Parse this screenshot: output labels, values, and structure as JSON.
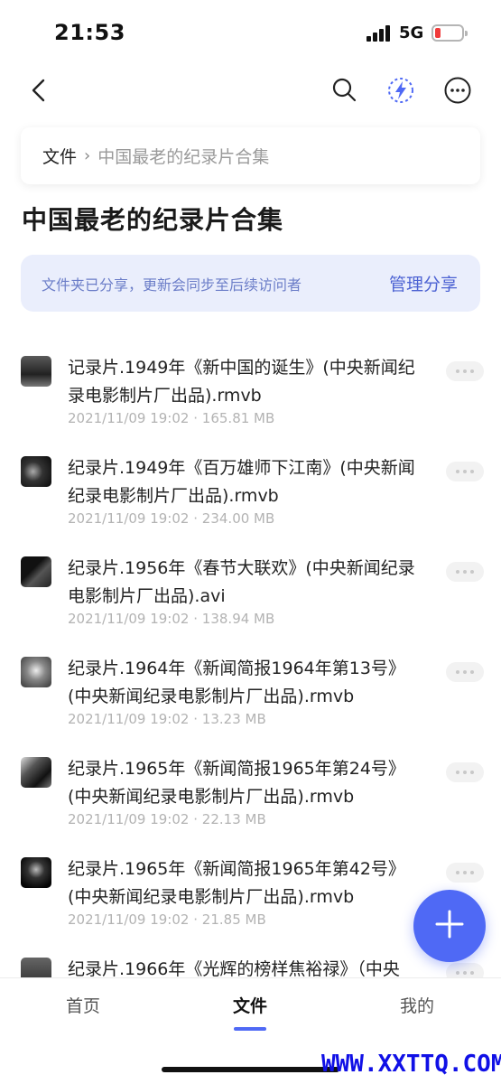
{
  "status_bar": {
    "time": "21:53",
    "network": "5G"
  },
  "breadcrumb": {
    "root": "文件",
    "separator": "›",
    "current": "中国最老的纪录片合集"
  },
  "page_title": "中国最老的纪录片合集",
  "share_banner": {
    "text": "文件夹已分享，更新会同步至后续访问者",
    "action": "管理分享"
  },
  "files": [
    {
      "name": "记录片.1949年《新中国的诞生》(中央新闻纪录电影制片厂出品).rmvb",
      "date": "2021/11/09 19:02",
      "size": "165.81 MB"
    },
    {
      "name": "纪录片.1949年《百万雄师下江南》(中央新闻纪录电影制片厂出品).rmvb",
      "date": "2021/11/09 19:02",
      "size": "234.00 MB"
    },
    {
      "name": "纪录片.1956年《春节大联欢》(中央新闻纪录电影制片厂出品).avi",
      "date": "2021/11/09 19:02",
      "size": "138.94 MB"
    },
    {
      "name": "纪录片.1964年《新闻简报1964年第13号》(中央新闻纪录电影制片厂出品).rmvb",
      "date": "2021/11/09 19:02",
      "size": "13.23 MB"
    },
    {
      "name": "纪录片.1965年《新闻简报1965年第24号》(中央新闻纪录电影制片厂出品).rmvb",
      "date": "2021/11/09 19:02",
      "size": "22.13 MB"
    },
    {
      "name": "纪录片.1965年《新闻简报1965年第42号》(中央新闻纪录电影制片厂出品).rmvb",
      "date": "2021/11/09 19:02",
      "size": "21.85 MB"
    },
    {
      "name": "纪录片.1966年《光辉的榜样焦裕禄》（中央",
      "date": "",
      "size": ""
    }
  ],
  "meta_separator": "·",
  "tabs": {
    "home": "首页",
    "files": "文件",
    "mine": "我的"
  },
  "watermark": "WWW.XXTTQ.COM",
  "colors": {
    "accent": "#4f69f5",
    "banner_bg": "#eaeefc",
    "battery_low": "#f03b3b"
  },
  "icons": {
    "back": "back-icon",
    "search": "search-icon",
    "quick": "lightning-icon",
    "more": "more-icon",
    "add": "plus-icon"
  }
}
